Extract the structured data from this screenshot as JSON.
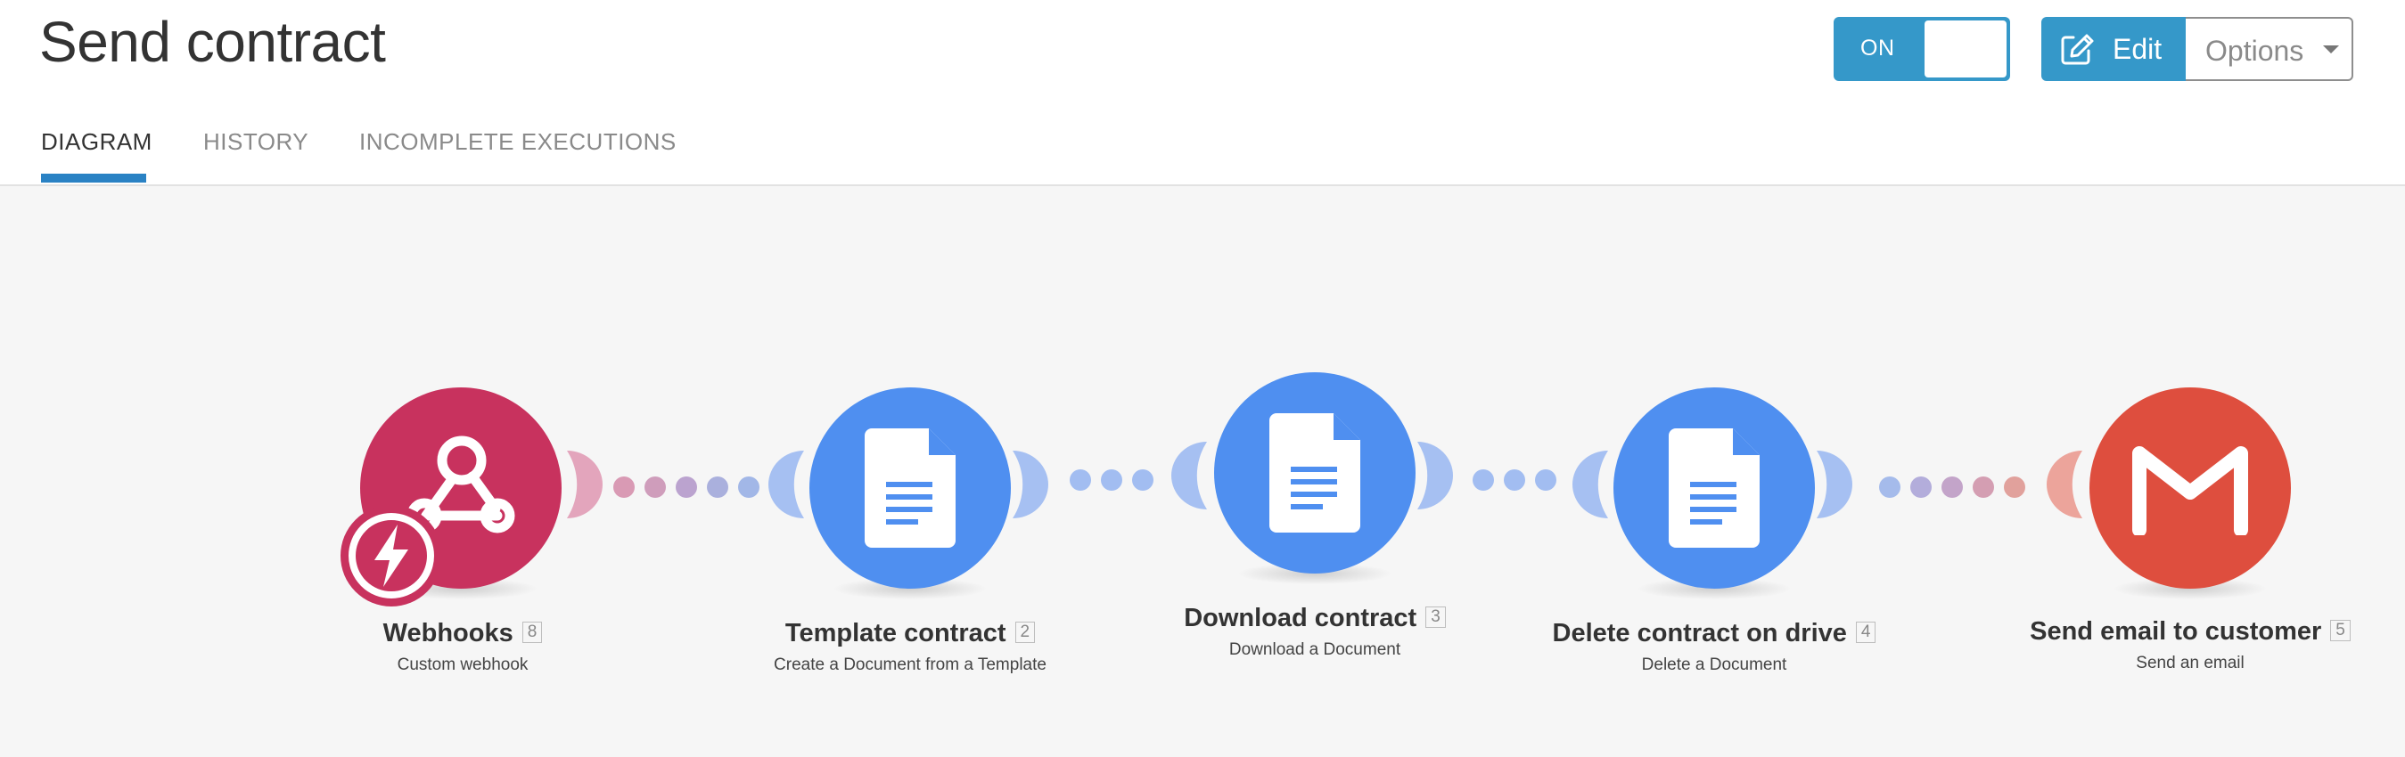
{
  "page": {
    "title": "Send contract"
  },
  "tabs": [
    {
      "label": "DIAGRAM",
      "active": true
    },
    {
      "label": "HISTORY",
      "active": false
    },
    {
      "label": "INCOMPLETE EXECUTIONS",
      "active": false
    }
  ],
  "toolbar": {
    "toggle_label": "ON",
    "edit_label": "Edit",
    "options_label": "Options"
  },
  "colors": {
    "accent": "#3598c9",
    "webhooks": "#c8325e",
    "google_docs": "#4f8ff0",
    "gmail": "#de4e3e"
  },
  "modules": [
    {
      "name": "Webhooks",
      "id": "8",
      "subtitle": "Custom webhook",
      "icon": "webhook-icon",
      "trigger_icon": "lightning-icon"
    },
    {
      "name": "Template contract",
      "id": "2",
      "subtitle": "Create a Document from a Template",
      "icon": "google-docs-icon"
    },
    {
      "name": "Download contract",
      "id": "3",
      "subtitle": "Download a Document",
      "icon": "google-docs-icon"
    },
    {
      "name": "Delete contract on drive",
      "id": "4",
      "subtitle": "Delete a Document",
      "icon": "google-docs-icon"
    },
    {
      "name": "Send email to customer",
      "id": "5",
      "subtitle": "Send an email",
      "icon": "gmail-icon"
    }
  ]
}
